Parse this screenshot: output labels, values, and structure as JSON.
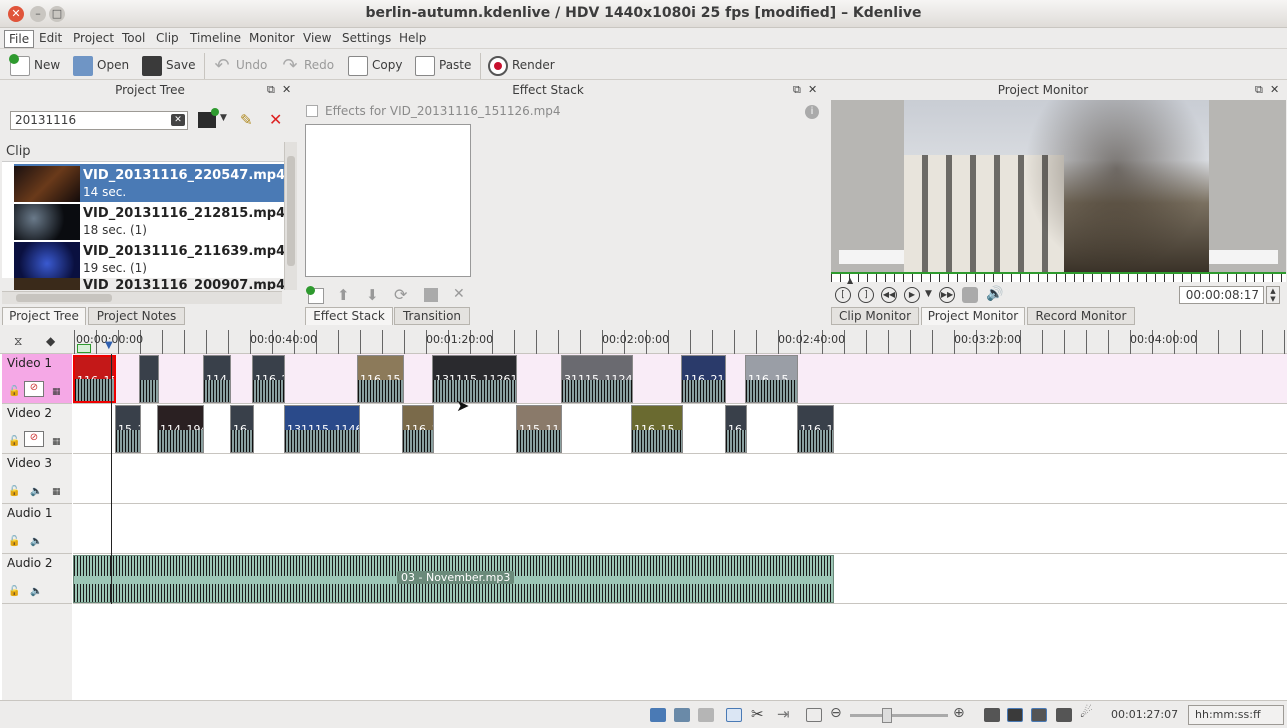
{
  "window": {
    "title": "berlin-autumn.kdenlive / HDV 1440x1080i 25 fps [modified] – Kdenlive"
  },
  "menu": [
    "File",
    "Edit",
    "Project",
    "Tool",
    "Clip",
    "Timeline",
    "Monitor",
    "View",
    "Settings",
    "Help"
  ],
  "toolbar": {
    "new": "New",
    "open": "Open",
    "save": "Save",
    "undo": "Undo",
    "redo": "Redo",
    "copy": "Copy",
    "paste": "Paste",
    "render": "Render"
  },
  "project_tree": {
    "title": "Project Tree",
    "search_value": "20131116",
    "header": "Clip",
    "clips": [
      {
        "name": "VID_20131116_220547.mp4",
        "duration": "14 sec."
      },
      {
        "name": "VID_20131116_212815.mp4",
        "duration": "18 sec. (1)"
      },
      {
        "name": "VID_20131116_211639.mp4",
        "duration": "19 sec. (1)"
      },
      {
        "name": "VID_20131116_200907.mp4",
        "duration": ""
      }
    ],
    "tabs": [
      "Project Tree",
      "Project Notes"
    ]
  },
  "effect_stack": {
    "title": "Effect Stack",
    "effects_for": "Effects for VID_20131116_151126.mp4",
    "tabs": [
      "Effect Stack",
      "Transition"
    ]
  },
  "project_monitor": {
    "title": "Project Monitor",
    "timecode": "00:00:08:17",
    "tabs": [
      "Clip Monitor",
      "Project Monitor",
      "Record Monitor"
    ]
  },
  "timeline": {
    "ruler": [
      "00:00:00:00",
      "00:00:40:00",
      "00:01:20:00",
      "00:02:00:00",
      "00:02:40:00",
      "00:03:20:00",
      "00:04:00:00"
    ],
    "tracks": [
      "Video 1",
      "Video 2",
      "Video 3",
      "Audio 1",
      "Audio 2"
    ],
    "video1_clips": [
      "116_15",
      "",
      "114_",
      "116_2",
      "116_15",
      "131115_112614",
      "31115_11243",
      "116_21",
      "116_15"
    ],
    "video2_clips": [
      "15_1",
      "114_194",
      "16_1",
      "131115_1146",
      "116_1",
      "115_11",
      "116_15",
      "16_",
      "116_1"
    ],
    "audio_clip": "03 - November.mp3"
  },
  "status": {
    "timecode": "00:01:27:07",
    "format": "hh:mm:ss:ff"
  },
  "colors": {
    "accent": "#4a7ab5",
    "video_track": "#f9ecf7",
    "record": "#c8102e"
  }
}
